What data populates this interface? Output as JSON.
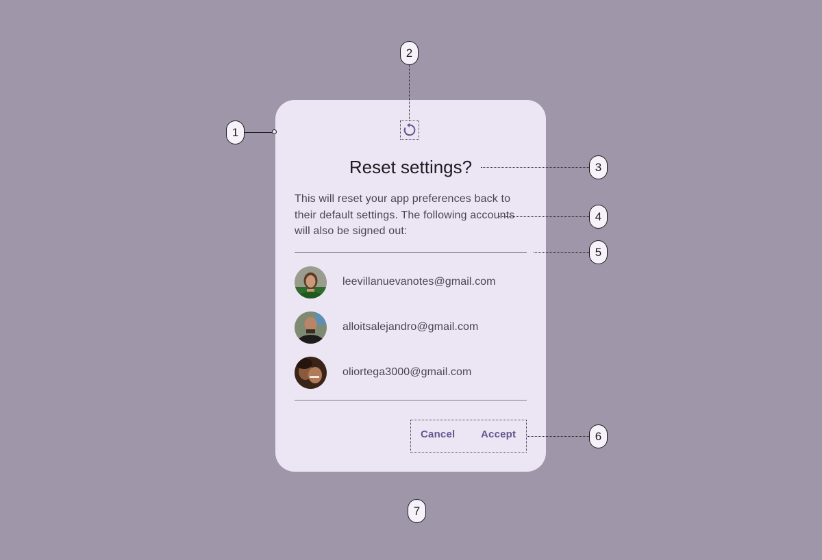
{
  "dialog": {
    "icon": "reset-icon",
    "title": "Reset settings?",
    "body": "This will reset your app preferences back to their default settings. The following accounts will also be signed out:",
    "accounts": [
      {
        "email": "leevillanuevanotes@gmail.com",
        "avatar": "avatar-woman"
      },
      {
        "email": "alloitsalejandro@gmail.com",
        "avatar": "avatar-man"
      },
      {
        "email": "oliortega3000@gmail.com",
        "avatar": "avatar-couple"
      }
    ],
    "actions": {
      "cancel_label": "Cancel",
      "accept_label": "Accept"
    }
  },
  "callouts": [
    "1",
    "2",
    "3",
    "4",
    "5",
    "6",
    "7"
  ],
  "colors": {
    "background": "#9f97a9",
    "dialog_surface": "#ece6f4",
    "primary": "#65558f",
    "on_surface": "#1d1b20",
    "on_surface_variant": "#49454f",
    "outline": "#79747e"
  }
}
